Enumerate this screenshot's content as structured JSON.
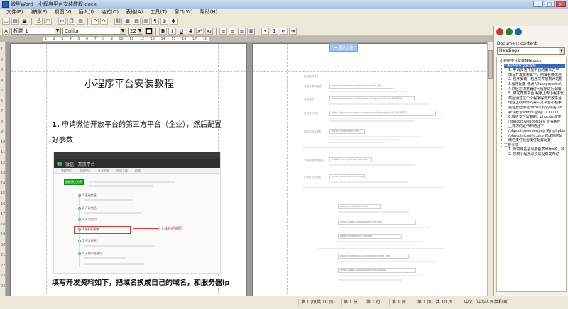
{
  "window": {
    "title": "微型Word - 小程序平台安装教程.docx",
    "buttons": [
      "_",
      "□",
      "×"
    ]
  },
  "menu": [
    "文件(F)",
    "编辑(E)",
    "视图(V)",
    "插入(I)",
    "格式(O)",
    "表格(A)",
    "工具(T)",
    "窗口(W)",
    "帮助(H)"
  ],
  "format_toolbar": {
    "style": "标题 1",
    "font": "Calibri",
    "size": "22",
    "buttons": [
      "B",
      "I",
      "U",
      "S",
      "x²",
      "x₂"
    ]
  },
  "ruler_ticks": [
    "1",
    "2",
    "3",
    "4",
    "5",
    "6",
    "7",
    "8",
    "9",
    "10",
    "11",
    "12",
    "13",
    "14",
    "15",
    "16",
    "17",
    "18"
  ],
  "vruler_ticks": [
    "1",
    "2",
    "3",
    "4",
    "5",
    "6",
    "7",
    "8",
    "9",
    "10",
    "11",
    "12",
    "13",
    "14",
    "15",
    "16",
    "17",
    "18",
    "19",
    "20",
    "21",
    "22",
    "23",
    "24"
  ],
  "document": {
    "title": "小程序平台安装教程",
    "heading_num": "1.",
    "heading_text": "申请微信开放平台的第三方平台（企业），然后配置好参数",
    "screenshot": {
      "brand": "微信 · 开放平台",
      "nav": [
        "管理中心",
        "资源中心",
        "开发资源",
        "应用下载",
        "帮助"
      ],
      "button": "创建第三方平台",
      "steps": [
        "1 基础信息",
        "2 开发信息",
        "3 开发资料",
        "4 授权权限集",
        "5 开发配置",
        "6 开放平台账号"
      ],
      "callout": "下载完后按照"
    },
    "bottom_text": "填写开发资料如下，把域名换成自己的域名，和服务器ip",
    "upload_label": "图片上传"
  },
  "page2": {
    "labels": [
      "接收授权事件",
      "消息与事件接收",
      "开发域名",
      "白名单IP地址",
      "授权发起页域名",
      "小程序服务器域名",
      "小程序业务域名"
    ],
    "urls": [
      "www.yourdomain.com/wxopen/auth.php",
      "www.yourdomain.com/wxopen/msg.php?appid=$APPID$",
      "https://www.yourdomain.com/api/notify.php?appid=$APPID$",
      "www.yourdomain.com",
      "https://www.yourdomain.com",
      "www.yourdomain.com/api",
      "https://www.yourdomain.com/api/",
      "www.yourdomain.com/wxapp/index.php",
      "https://www.yourdomain.com/wxapp/"
    ]
  },
  "sidebar": {
    "title": "Document content:",
    "select": "Headings",
    "items": [
      "小程序平台安装教程.docx",
      "小程序平台安装教程",
      "1. 申请微信开放平台的第三方平",
      "填写开发资料如下，把域名换成自",
      "2. 程序安装：程序文件放到网站根",
      "3.程序配置 修改 \\Dosage\\extra\\",
      "4.然后在浏览器访问程序进行配置",
      "5. 绑定开放平台 程序上传小程序代",
      "然后通过这个小程序得到开放平台",
      "他这上线到你的第三方平台小程序",
      "后台登陆地址https://你的域名/ad",
      "默认账号admin 密码：111111",
      "6.微信支付需要的，phpcoin文件",
      "/phpcoin/vendor/pay 证书路径",
      "上传你的证书到路径下",
      "/phpcoin/vendor/pay 执行phpbin",
      "/phpcoin/config.php 修改你的配",
      "微信支付后台支付配置配置",
      "主要事项",
      "1. 你的域名必须要备案https的，缺",
      "2. 授权小程序必须是没有发布过"
    ]
  },
  "status": {
    "page": "第 1 页(共 10 页)",
    "section": "第 1 节",
    "line": "第 1 行",
    "col": "第 1 列",
    "pos": "第 1 页，共 10 页",
    "lang": "中文（中华人民共和国）"
  }
}
